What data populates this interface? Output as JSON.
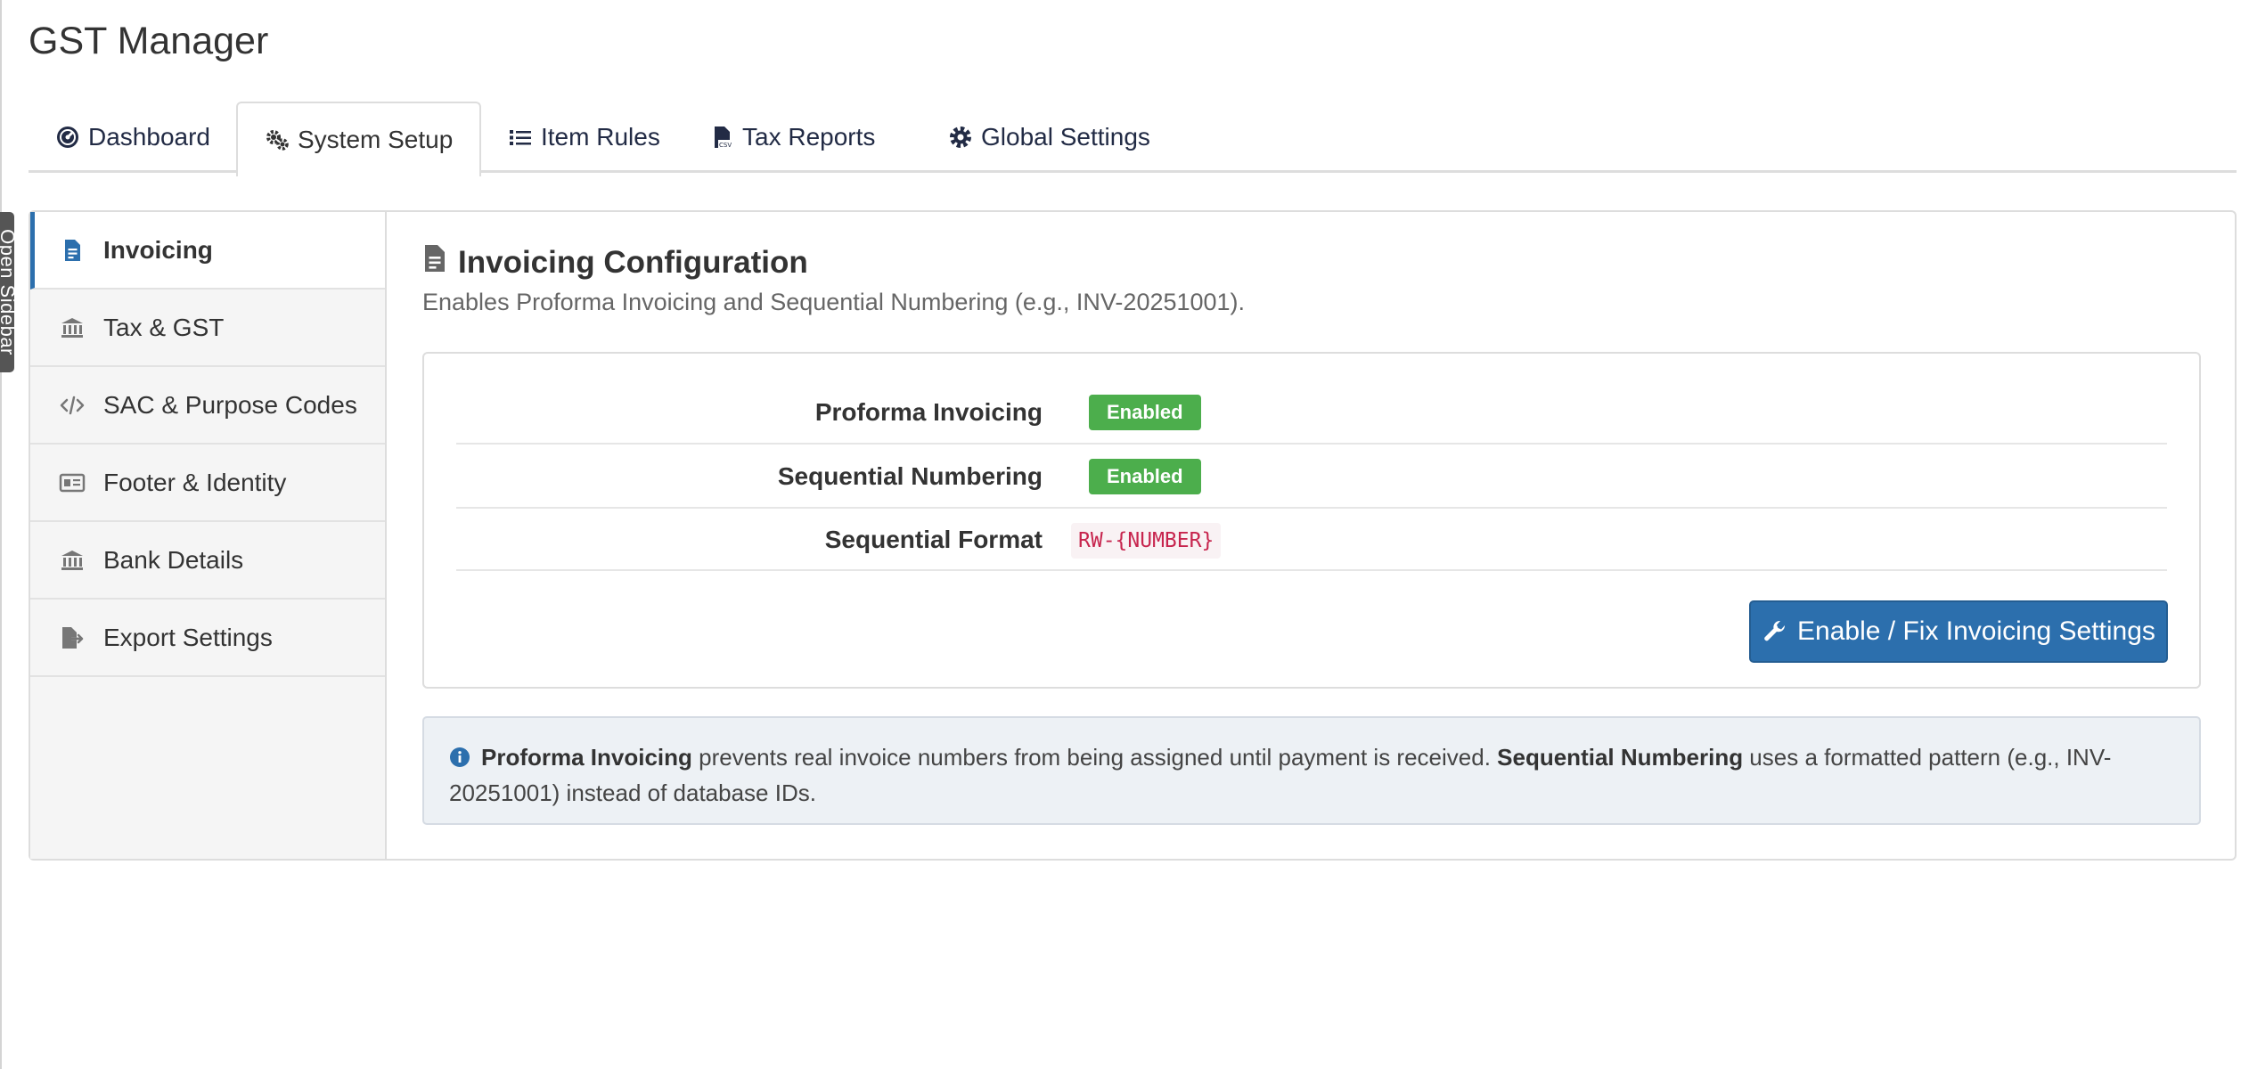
{
  "app": {
    "title": "GST Manager"
  },
  "sidebar_toggle": {
    "label": "Open Sidebar"
  },
  "tabs": [
    {
      "label": "Dashboard",
      "icon": "dashboard-icon"
    },
    {
      "label": "System Setup",
      "icon": "gears-icon",
      "active": true
    },
    {
      "label": "Item Rules",
      "icon": "list-icon"
    },
    {
      "label": "Tax Reports",
      "icon": "csv-file-icon"
    },
    {
      "label": "Global Settings",
      "icon": "gear-icon"
    }
  ],
  "nav": [
    {
      "label": "Invoicing",
      "icon": "invoice-icon",
      "active": true
    },
    {
      "label": "Tax & GST",
      "icon": "bank-icon"
    },
    {
      "label": "SAC & Purpose Codes",
      "icon": "code-icon"
    },
    {
      "label": "Footer & Identity",
      "icon": "id-card-icon"
    },
    {
      "label": "Bank Details",
      "icon": "bank-icon"
    },
    {
      "label": "Export Settings",
      "icon": "file-export-icon"
    }
  ],
  "section": {
    "title": "Invoicing Configuration",
    "subtitle": "Enables Proforma Invoicing and Sequential Numbering (e.g., INV-20251001)."
  },
  "settings": [
    {
      "label": "Proforma Invoicing",
      "status": "Enabled"
    },
    {
      "label": "Sequential Numbering",
      "status": "Enabled"
    },
    {
      "label": "Sequential Format",
      "value": "RW-{NUMBER}"
    }
  ],
  "action": {
    "label": "Enable / Fix Invoicing Settings",
    "icon": "wrench-icon"
  },
  "info": {
    "term1": "Proforma Invoicing",
    "text1": " prevents real invoice numbers from being assigned until payment is received. ",
    "term2": "Sequential Numbering",
    "text2": " uses a formatted pattern (e.g., INV-20251001) instead of database IDs."
  },
  "colors": {
    "primary": "#2c6fad",
    "success": "#4cae4c",
    "code_text": "#c7254e",
    "info_bg": "#edf1f5"
  }
}
